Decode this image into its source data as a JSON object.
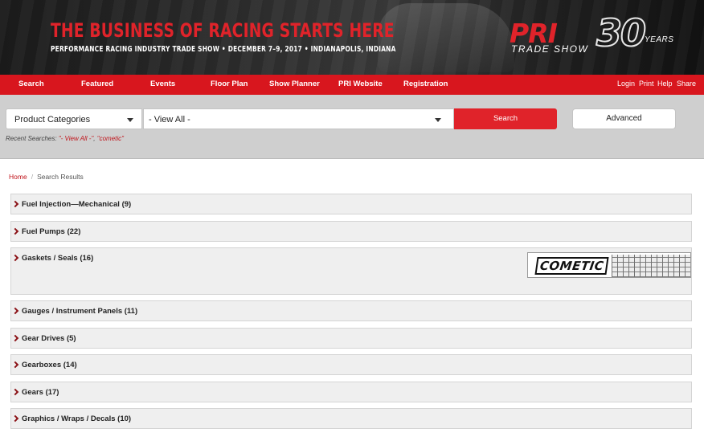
{
  "banner": {
    "headline": "THE BUSINESS OF RACING STARTS HERE",
    "subline": "PERFORMANCE RACING INDUSTRY TRADE SHOW  •  DECEMBER 7–9, 2017  •  INDIANAPOLIS, INDIANA",
    "logo": {
      "pri": "PRI",
      "thirty": "30",
      "years": "YEARS",
      "trade_show": "TRADE SHOW"
    }
  },
  "nav": {
    "items": [
      "Search",
      "Featured",
      "Events",
      "Floor Plan",
      "Show Planner",
      "PRI Website",
      "Registration"
    ],
    "utility": [
      "Login",
      "Print",
      "Help",
      "Share"
    ]
  },
  "search": {
    "category_select": "Product Categories",
    "value_select": "- View All -",
    "search_button": "Search",
    "advanced_button": "Advanced",
    "recent_label": "Recent Searches: ",
    "recent": [
      "\"- View All -\"",
      "\"cometic\""
    ]
  },
  "breadcrumb": {
    "home": "Home",
    "separator": "/",
    "current": "Search Results"
  },
  "categories": [
    "Fuel Injection—Mechanical (9)",
    "Fuel Pumps (22)",
    "Gaskets / Seals (16)",
    "Gauges / Instrument Panels (11)",
    "Gear Drives (5)",
    "Gearboxes (14)",
    "Gears (17)",
    "Graphics / Wraps / Decals (10)"
  ],
  "ad": {
    "brand": "COMETIC"
  },
  "colors": {
    "brand_red": "#d8161e",
    "search_red": "#e0232a",
    "link_red": "#c0141b",
    "arrow": "#8b1217"
  }
}
